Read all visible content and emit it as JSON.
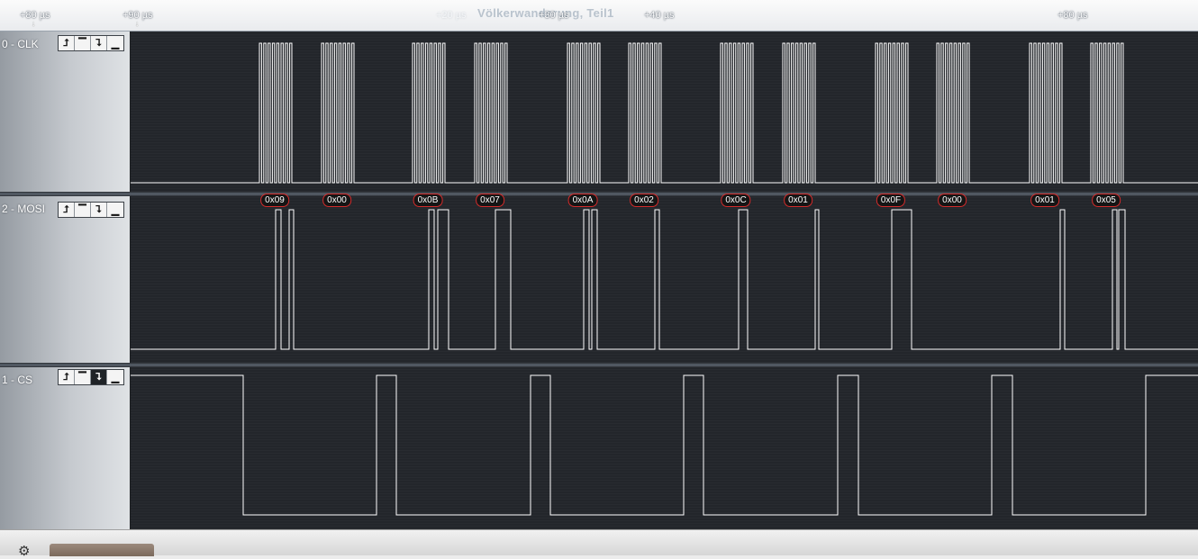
{
  "timebar": {
    "ticks": [
      {
        "label": "+80 µs",
        "faint": false,
        "arrow": true
      },
      {
        "label": "+90 µs",
        "faint": false,
        "arrow": true
      },
      {
        "label": "+20 µs",
        "faint": true,
        "arrow": false
      },
      {
        "label": "+30 µs",
        "faint": false,
        "arrow": false
      },
      {
        "label": "+40 µs",
        "faint": false,
        "arrow": false
      },
      {
        "label": "+80 µs",
        "faint": false,
        "arrow": false
      }
    ],
    "ghost_title": "Völkerwanderung, Teil1"
  },
  "channels": [
    {
      "name": "0 - CLK",
      "active_trigger": -1
    },
    {
      "name": "2 - MOSI",
      "active_trigger": -1
    },
    {
      "name": "1 - CS",
      "active_trigger": 2
    }
  ],
  "trigger_buttons": [
    "rising-edge",
    "high-level",
    "falling-edge",
    "low-level"
  ],
  "trigger_glyphs": [
    "⮥",
    "▔",
    "⮧",
    "▁"
  ],
  "decoded_bytes": [
    "0x09",
    "0x00",
    "0x0B",
    "0x07",
    "0x0A",
    "0x02",
    "0x0C",
    "0x01",
    "0x0F",
    "0x00",
    "0x01",
    "0x05"
  ],
  "colors": {
    "waveform": "#ffffff",
    "badge_border": "#d32b2b",
    "wave_bg": "#23262b"
  }
}
